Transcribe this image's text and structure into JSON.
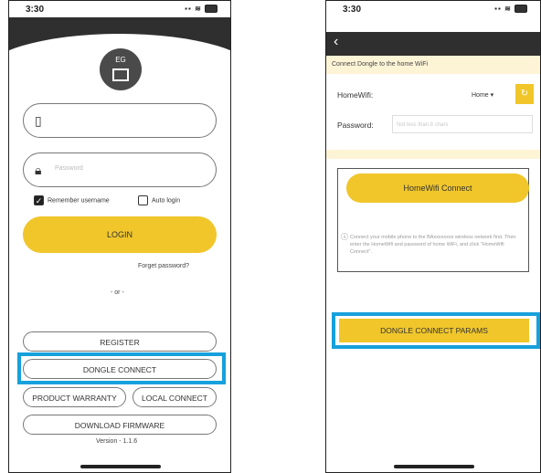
{
  "left_screen": {
    "time": "3:30",
    "logo_text": "EG",
    "password_placeholder": "Password",
    "remember_label": "Remember username",
    "remember_check": "✓",
    "auto_login_label": "Auto login",
    "login_label": "LOGIN",
    "forget_password": "Forget password?",
    "or_text": "- or -",
    "register_label": "REGISTER",
    "dongle_connect_label": "DONGLE CONNECT",
    "product_warranty_label": "PRODUCT WARRANTY",
    "local_connect_label": "LOCAL CONNECT",
    "download_firmware_label": "DOWNLOAD FIRMWARE",
    "version": "Version - 1.1.6"
  },
  "right_screen": {
    "time": "3:30",
    "back_glyph": "‹",
    "banner": "Connect Dongle to the home WiFi",
    "homewifi_label": "HomeWifi:",
    "homewifi_value": "Home ▾",
    "refresh_glyph": "↻",
    "password_label": "Password:",
    "password_placeholder": "Not less than 8 chars",
    "homewifi_connect_label": "HomeWifi Connect",
    "info_glyph": "ⓘ",
    "info_text": "Connect your mobile phone to the BAxxxxxxxx wireless network first. Then enter the HomeWifi and password of home WiFi, and click \"HomeWifi Connect\".",
    "dongle_connect_params_label": "DONGLE CONNECT PARAMS"
  },
  "colors": {
    "accent_yellow": "#f0c62b",
    "highlight_blue": "#17a0dc",
    "header_dark": "#2f2f2f"
  }
}
